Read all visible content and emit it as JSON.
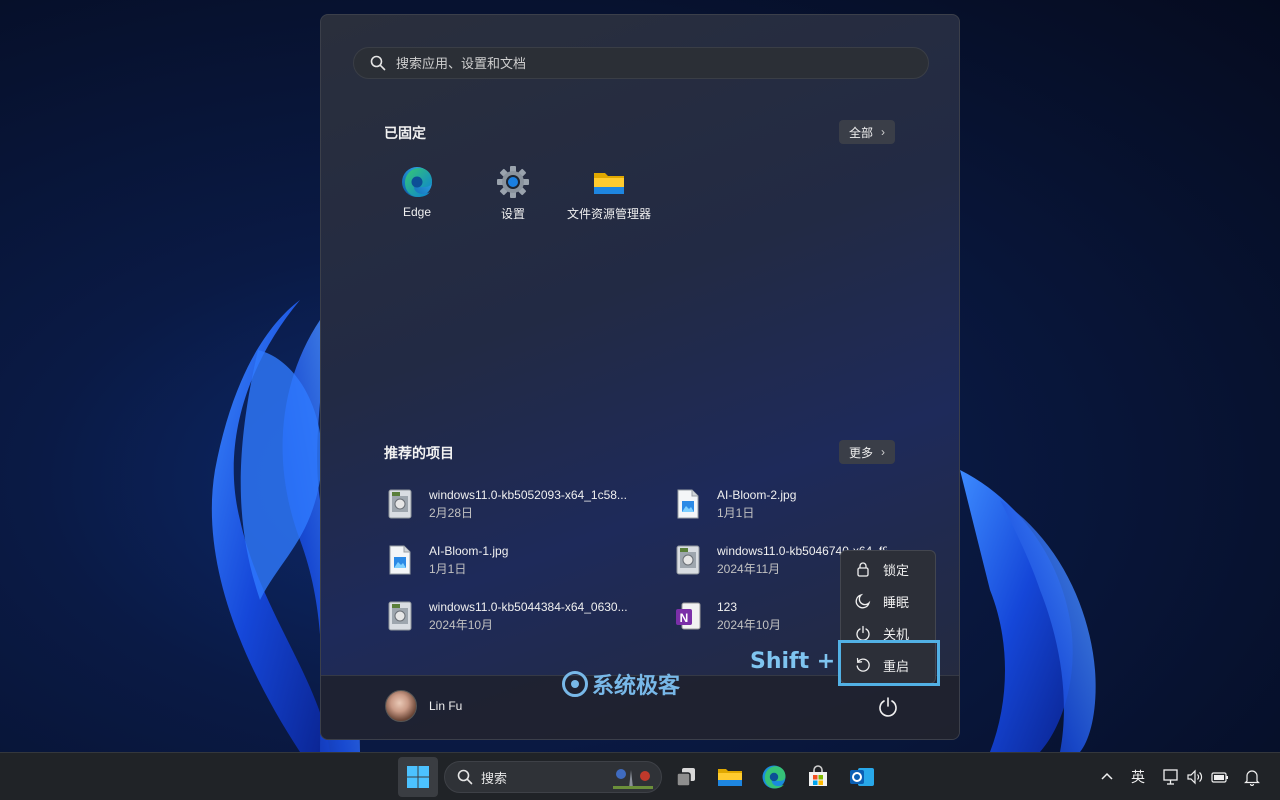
{
  "start_menu": {
    "search_placeholder": "搜索应用、设置和文档",
    "pinned": {
      "title": "已固定",
      "all_button": "全部",
      "items": [
        {
          "label": "Edge",
          "icon": "edge-icon"
        },
        {
          "label": "设置",
          "icon": "settings-gear-icon"
        },
        {
          "label": "文件资源管理器",
          "icon": "folder-icon"
        }
      ]
    },
    "recommended": {
      "title": "推荐的项目",
      "more_button": "更多",
      "items": [
        {
          "name": "windows11.0-kb5052093-x64_1c58...",
          "date": "2月28日",
          "icon": "installer-package-icon"
        },
        {
          "name": "AI-Bloom-2.jpg",
          "date": "1月1日",
          "icon": "image-file-icon"
        },
        {
          "name": "AI-Bloom-1.jpg",
          "date": "1月1日",
          "icon": "image-file-icon"
        },
        {
          "name": "windows11.0-kb5046740-x64_f805...",
          "date": "2024年11月",
          "icon": "installer-package-icon"
        },
        {
          "name": "windows11.0-kb5044384-x64_0630...",
          "date": "2024年10月",
          "icon": "installer-package-icon"
        },
        {
          "name": "123",
          "date": "2024年10月",
          "icon": "onenote-icon"
        }
      ]
    },
    "user": {
      "name": "Lin Fu"
    }
  },
  "power_menu": {
    "items": [
      {
        "label": "锁定",
        "icon": "lock-icon"
      },
      {
        "label": "睡眠",
        "icon": "moon-icon"
      },
      {
        "label": "关机",
        "icon": "power-icon"
      },
      {
        "label": "重启",
        "icon": "restart-icon"
      }
    ],
    "modifier_hint": "Shift +"
  },
  "watermark": {
    "text": "系统极客"
  },
  "taskbar": {
    "search_label": "搜索",
    "apps": [
      "start-icon",
      "task-view-icon",
      "file-explorer-icon",
      "edge-icon",
      "microsoft-store-icon",
      "outlook-icon"
    ],
    "tray": {
      "input_method": "英"
    }
  },
  "colors": {
    "highlight_border": "#52b1e5",
    "accent_blue": "#0078d4"
  }
}
